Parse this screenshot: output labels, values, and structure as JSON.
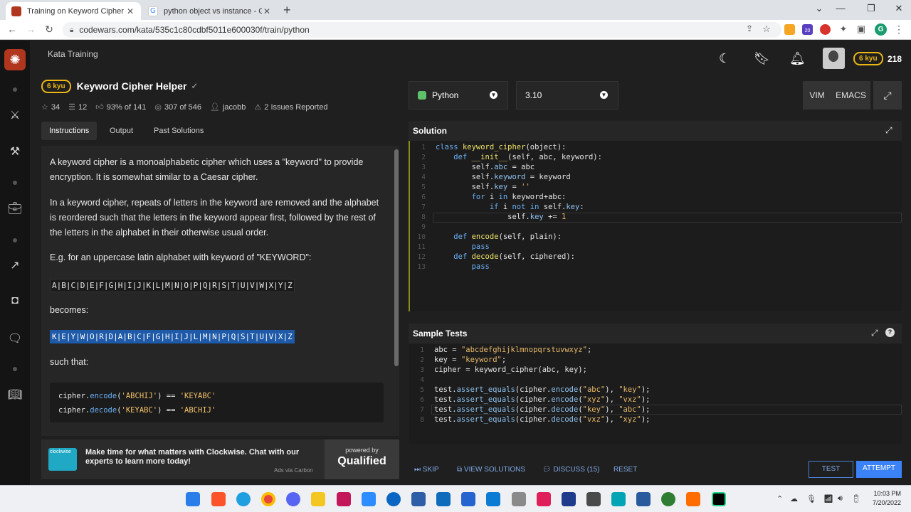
{
  "browser": {
    "tabs": [
      {
        "title": "Training on Keyword Cipher Help",
        "active": true
      },
      {
        "title": "python object vs instance - Goo",
        "active": false
      }
    ],
    "url": "codewars.com/kata/535c1c80cdbf5011e600030f/train/python",
    "profile_initial": "G",
    "ext_badge": "20"
  },
  "app": {
    "section_title": "Kata Training",
    "rank": "6 kyu",
    "honor": "218"
  },
  "kata": {
    "rank": "6 kyu",
    "title": "Keyword Cipher Helper",
    "stats": {
      "stars": "34",
      "collections": "12",
      "satisfaction": "93% of 141",
      "completed": "307 of 546",
      "author": "jacobb",
      "issues": "2 Issues Reported"
    },
    "tabs": [
      "Instructions",
      "Output",
      "Past Solutions"
    ],
    "description": {
      "p1": "A keyword cipher is a monoalphabetic cipher which uses a \"keyword\" to provide encryption. It is somewhat similar to a Caesar cipher.",
      "p2": "In a keyword cipher, repeats of letters in the keyword are removed and the alphabet is reordered such that the letters in the keyword appear first, followed by the rest of the letters in the alphabet in their otherwise usual order.",
      "p3": "E.g. for an uppercase latin alphabet with keyword of \"KEYWORD\":",
      "alphabet": "A|B|C|D|E|F|G|H|I|J|K|L|M|N|O|P|Q|R|S|T|U|V|W|X|Y|Z",
      "becomes": "becomes:",
      "cipher_alphabet": "K|E|Y|W|O|R|D|A|B|C|F|G|H|I|J|L|M|N|P|Q|S|T|U|V|X|Z",
      "such_that": "such that:"
    }
  },
  "ad": {
    "logo_text": "clockwise",
    "text": "Make time for what matters with Clockwise. Chat with our experts to learn more today!",
    "via": "Ads via Carbon",
    "powered_by": "powered by",
    "brand": "Qualified"
  },
  "editor_toolbar": {
    "language": "Python",
    "version": "3.10",
    "modes": [
      "VIM",
      "EMACS"
    ]
  },
  "solution": {
    "title": "Solution"
  },
  "sample_tests": {
    "title": "Sample Tests"
  },
  "actions": {
    "skip": "SKIP",
    "view_solutions": "VIEW SOLUTIONS",
    "discuss": "DISCUSS (15)",
    "reset": "RESET",
    "test": "TEST",
    "attempt": "ATTEMPT"
  },
  "taskbar": {
    "time": "10:03 PM",
    "date": "7/20/2022"
  },
  "colors": {
    "codewars_red": "#b1361e",
    "rank_yellow": "#ecb613",
    "link_blue": "#7fa8e6",
    "attempt_blue": "#3b82f6"
  }
}
